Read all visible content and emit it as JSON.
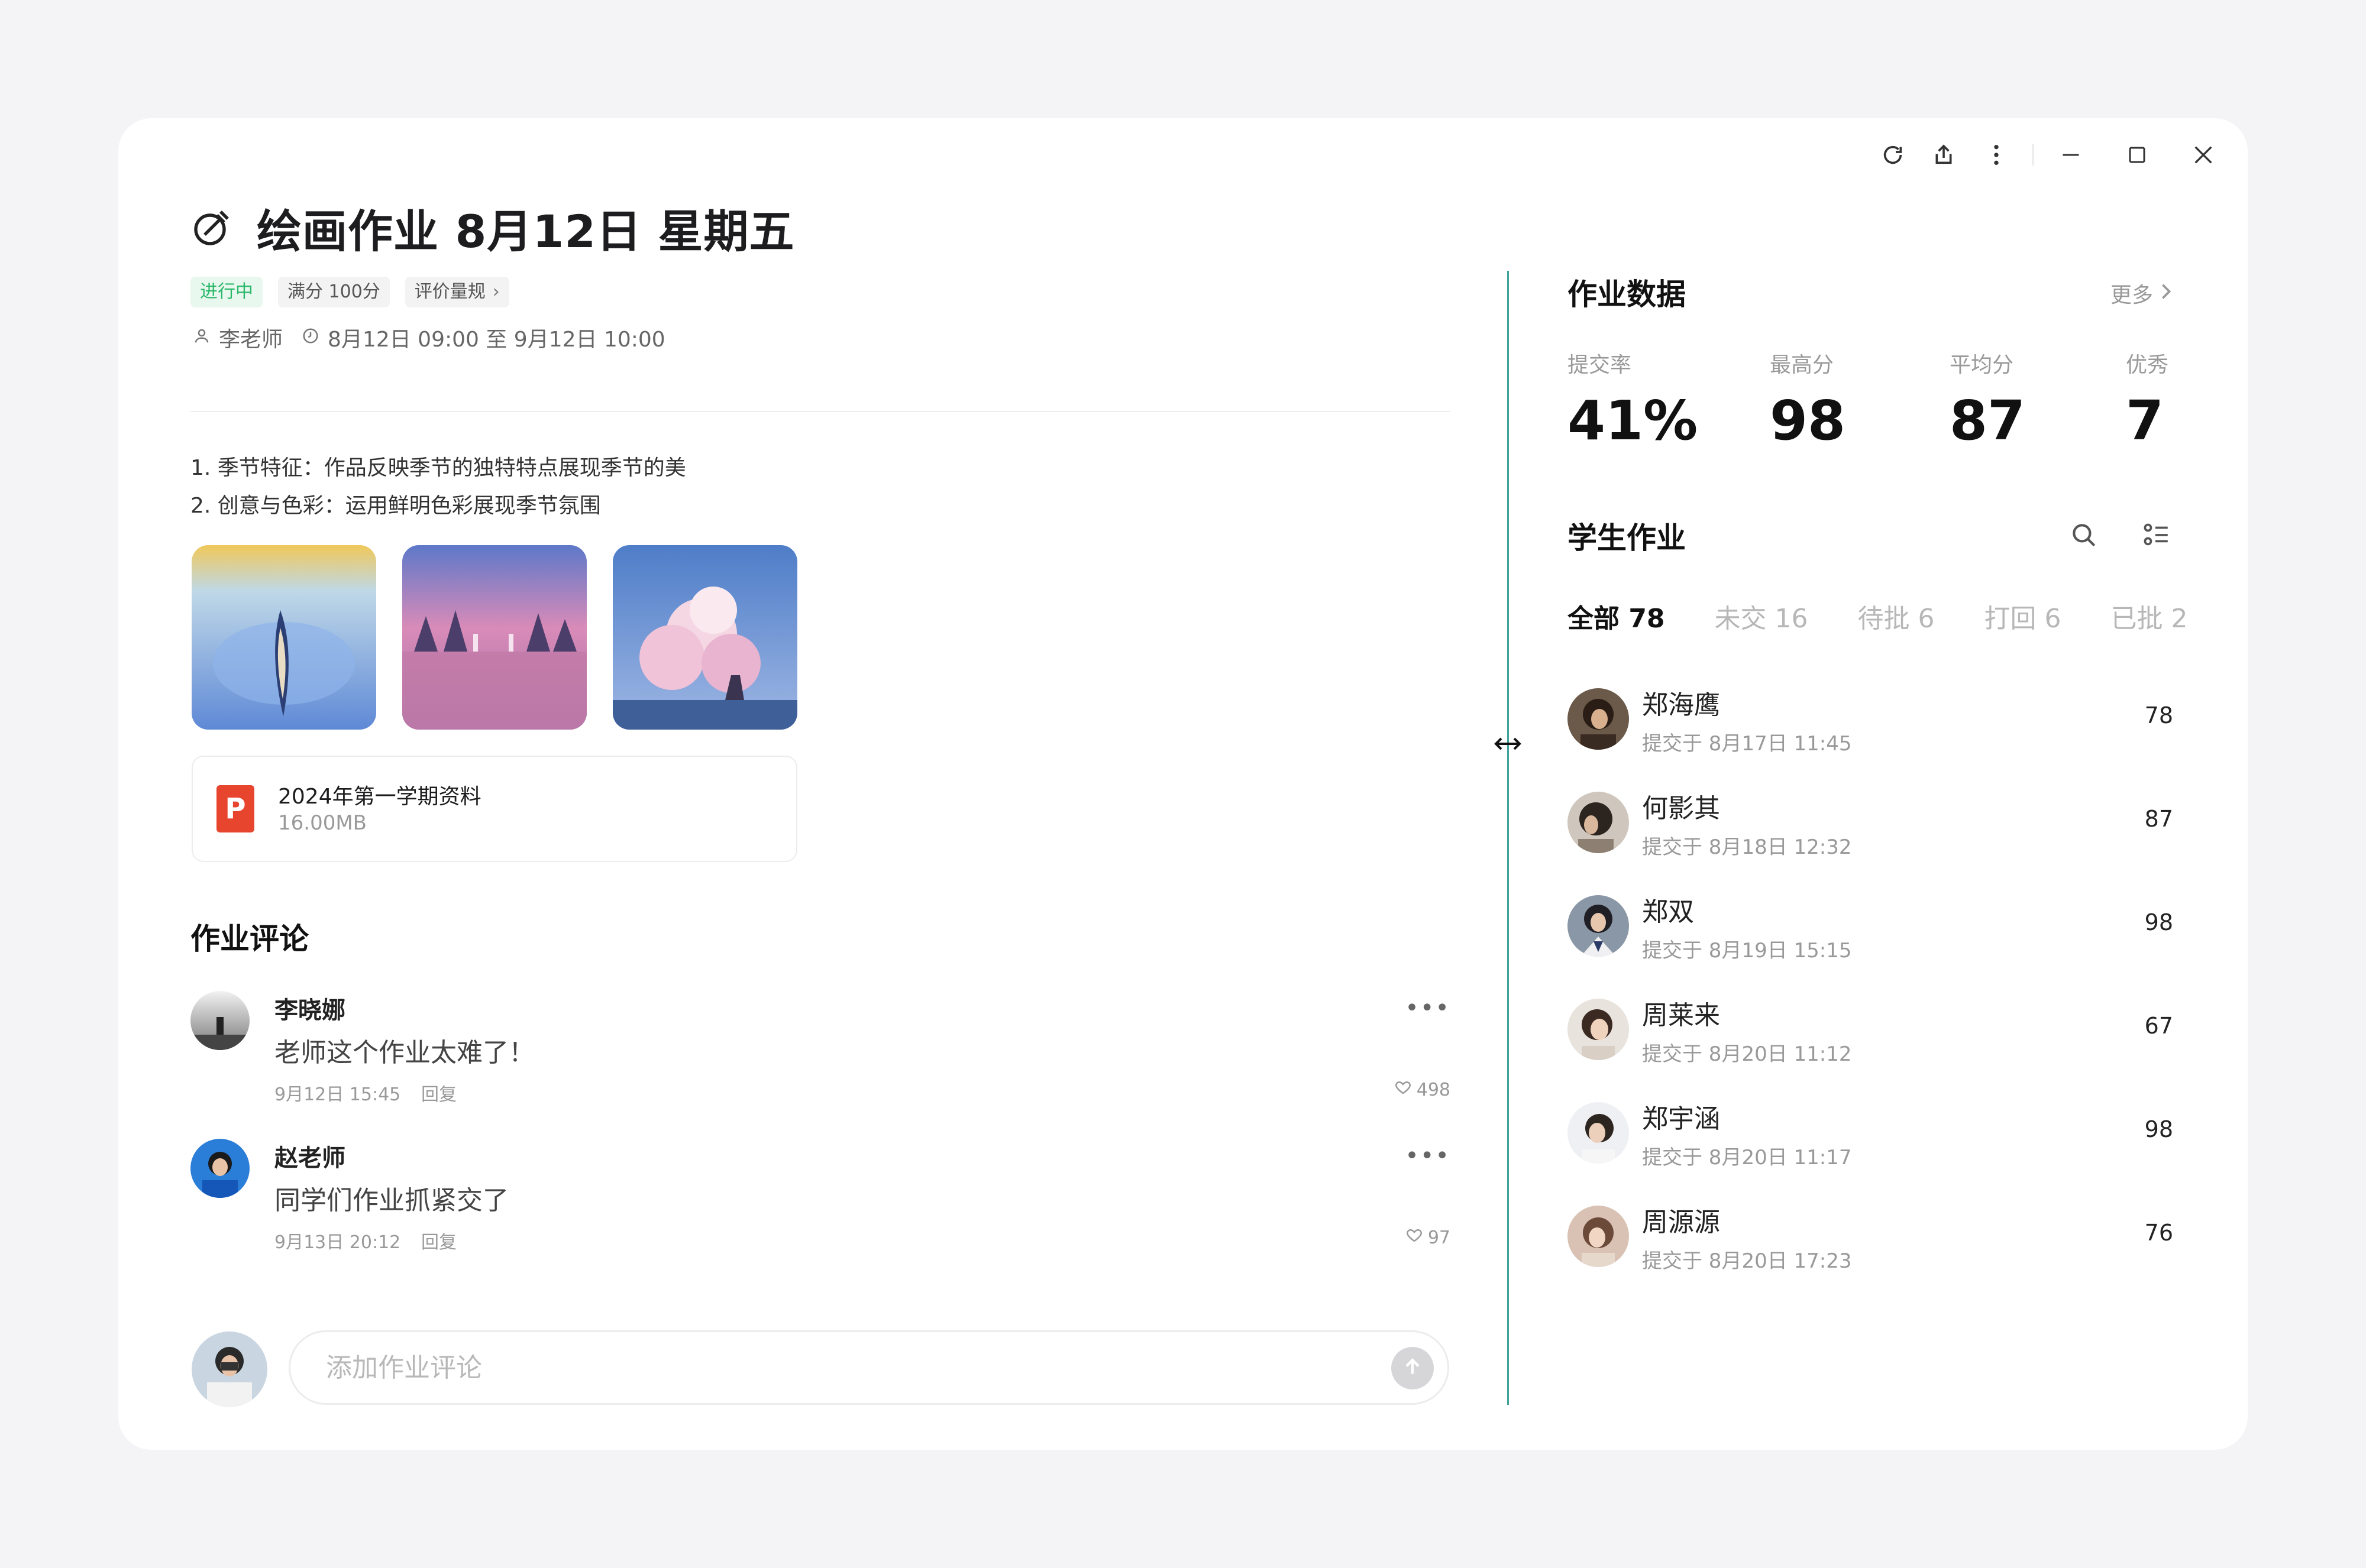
{
  "header": {
    "title": "绘画作业 8月12日 星期五",
    "tags": {
      "status": "进行中",
      "full_score": "满分 100分",
      "rubric": "评价量规"
    },
    "teacher": "李老师",
    "time_range": "8月12日 09:00 至 9月12日 10:00"
  },
  "description": [
    "1. 季节特征：作品反映季节的独特特点展现季节的美",
    "2. 创意与色彩：运用鲜明色彩展现季节氛围"
  ],
  "attachment": {
    "name": "2024年第一学期资料",
    "size": "16.00MB",
    "icon_letter": "P"
  },
  "comments_section": {
    "title": "作业评论",
    "comments": [
      {
        "name": "李晓娜",
        "text": "老师这个作业太难了！",
        "time": "9月12日 15:45",
        "reply": "回复",
        "likes": "498"
      },
      {
        "name": "赵老师",
        "text": "同学们作业抓紧交了",
        "time": "9月13日 20:12",
        "reply": "回复",
        "likes": "97"
      }
    ],
    "input_placeholder": "添加作业评论"
  },
  "stats": {
    "title": "作业数据",
    "more": "更多",
    "items": [
      {
        "label": "提交率",
        "value": "41%"
      },
      {
        "label": "最高分",
        "value": "98"
      },
      {
        "label": "平均分",
        "value": "87"
      },
      {
        "label": "优秀",
        "value": "7"
      }
    ]
  },
  "homework": {
    "title": "学生作业",
    "tabs": [
      "全部 78",
      "未交 16",
      "待批 6",
      "打回 6",
      "已批 2"
    ],
    "students": [
      {
        "name": "郑海鹰",
        "time": "提交于 8月17日 11:45",
        "score": "78"
      },
      {
        "name": "何影其",
        "time": "提交于 8月18日 12:32",
        "score": "87"
      },
      {
        "name": "郑双",
        "time": "提交于 8月19日 15:15",
        "score": "98"
      },
      {
        "name": "周莱来",
        "time": "提交于 8月20日 11:12",
        "score": "67"
      },
      {
        "name": "郑宇涵",
        "time": "提交于 8月20日 11:17",
        "score": "98"
      },
      {
        "name": "周源源",
        "time": "提交于 8月20日 17:23",
        "score": "76"
      }
    ]
  },
  "colors": {
    "status_green": "#2ab86a",
    "divider_accent": "#3fa39a",
    "pdf_red": "#e8452f"
  }
}
